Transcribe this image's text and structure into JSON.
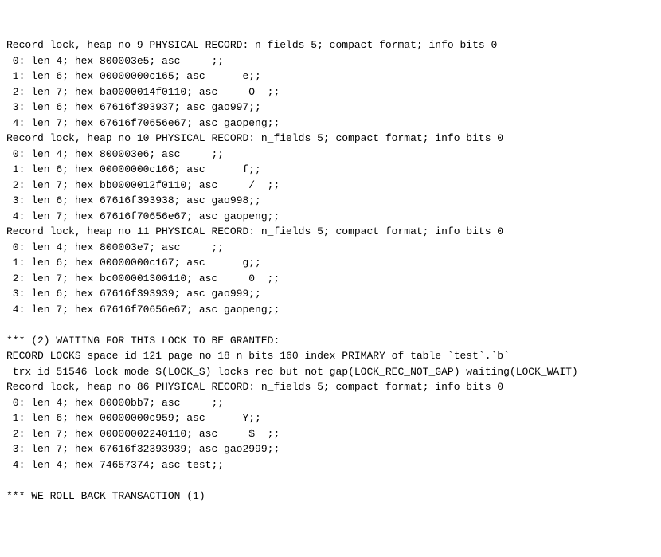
{
  "lines": [
    "Record lock, heap no 9 PHYSICAL RECORD: n_fields 5; compact format; info bits 0",
    " 0: len 4; hex 800003e5; asc     ;;",
    " 1: len 6; hex 00000000c165; asc      e;;",
    " 2: len 7; hex ba0000014f0110; asc     O  ;;",
    " 3: len 6; hex 67616f393937; asc gao997;;",
    " 4: len 7; hex 67616f70656e67; asc gaopeng;;",
    "Record lock, heap no 10 PHYSICAL RECORD: n_fields 5; compact format; info bits 0",
    " 0: len 4; hex 800003e6; asc     ;;",
    " 1: len 6; hex 00000000c166; asc      f;;",
    " 2: len 7; hex bb0000012f0110; asc     /  ;;",
    " 3: len 6; hex 67616f393938; asc gao998;;",
    " 4: len 7; hex 67616f70656e67; asc gaopeng;;",
    "Record lock, heap no 11 PHYSICAL RECORD: n_fields 5; compact format; info bits 0",
    " 0: len 4; hex 800003e7; asc     ;;",
    " 1: len 6; hex 00000000c167; asc      g;;",
    " 2: len 7; hex bc000001300110; asc     0  ;;",
    " 3: len 6; hex 67616f393939; asc gao999;;",
    " 4: len 7; hex 67616f70656e67; asc gaopeng;;",
    "",
    "*** (2) WAITING FOR THIS LOCK TO BE GRANTED:",
    "RECORD LOCKS space id 121 page no 18 n bits 160 index PRIMARY of table `test`.`b` ",
    " trx id 51546 lock mode S(LOCK_S) locks rec but not gap(LOCK_REC_NOT_GAP) waiting(LOCK_WAIT)",
    "Record lock, heap no 86 PHYSICAL RECORD: n_fields 5; compact format; info bits 0",
    " 0: len 4; hex 80000bb7; asc     ;;",
    " 1: len 6; hex 00000000c959; asc      Y;;",
    " 2: len 7; hex 00000002240110; asc     $  ;;",
    " 3: len 7; hex 67616f32393939; asc gao2999;;",
    " 4: len 4; hex 74657374; asc test;;",
    "",
    "*** WE ROLL BACK TRANSACTION (1)"
  ]
}
